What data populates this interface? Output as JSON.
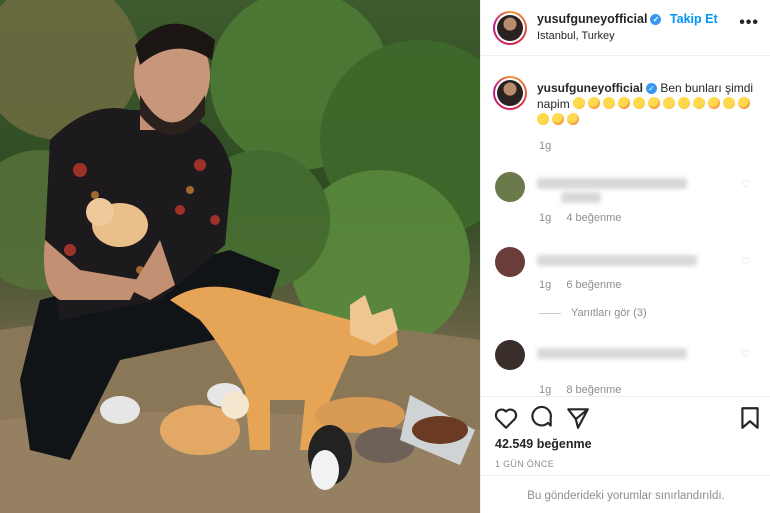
{
  "post": {
    "username": "yusufguneyofficial",
    "follow_label": "Takip Et",
    "location": "Istanbul, Turkey",
    "more_label": "•••",
    "caption_text": "Ben bunları şimdi napim",
    "caption_time": "1g",
    "caption_emoji_count": 15
  },
  "comments": [
    {
      "meta_time": "1g",
      "meta_likes": "4 beğenme",
      "avatar_color": "#6b7a4a"
    },
    {
      "meta_time": "1g",
      "meta_likes": "6 beğenme",
      "avatar_color": "#6a3d3a",
      "replies_label": "Yanıtları gör (3)"
    },
    {
      "meta_time": "1g",
      "meta_likes": "8 beğenme",
      "avatar_color": "#3a2e2a"
    }
  ],
  "actions": {
    "icons": [
      "heart-icon",
      "comment-icon",
      "share-icon",
      "bookmark-icon"
    ],
    "likes": "42.549 beğenme",
    "date": "1 GÜN ÖNCE",
    "restricted": "Bu gönderideki yorumlar sınırlandırıldı."
  },
  "colors": {
    "link_blue": "#0095f6",
    "verified_blue": "#3897f0",
    "muted_text": "#8e8e8e",
    "border": "#efefef"
  }
}
